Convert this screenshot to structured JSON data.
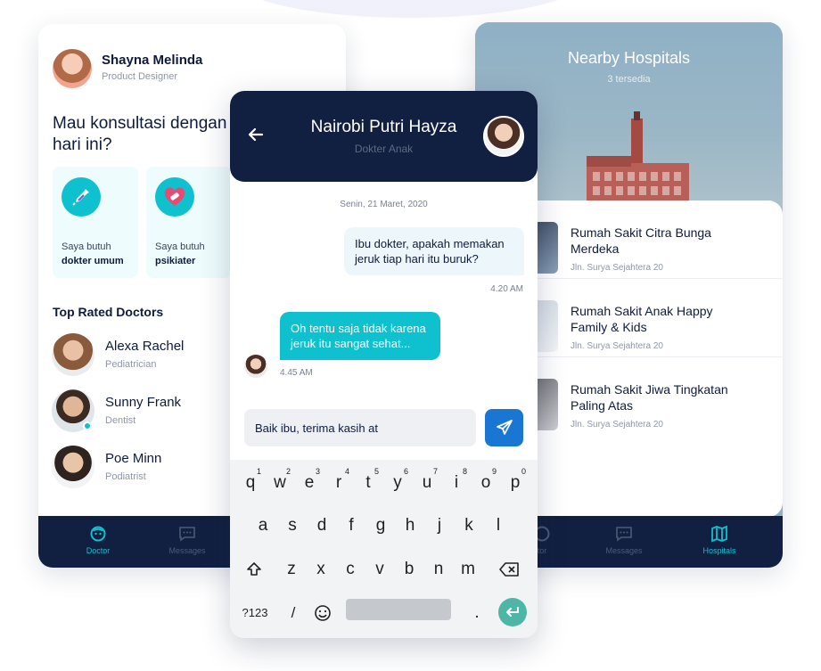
{
  "left_screen": {
    "profile": {
      "name": "Shayna Melinda",
      "role": "Product Designer"
    },
    "consult_title": "Mau konsultasi dengan siapa hari ini?",
    "categories": [
      {
        "icon": "syringe-icon",
        "line1": "Saya butuh",
        "line2": "dokter umum"
      },
      {
        "icon": "heart-bandage-icon",
        "line1": "Saya butuh",
        "line2": "psikiater"
      }
    ],
    "top_rated_title": "Top Rated Doctors",
    "doctors": [
      {
        "name": "Alexa Rachel",
        "specialty": "Pediatrician"
      },
      {
        "name": "Sunny Frank",
        "specialty": "Dentist"
      },
      {
        "name": "Poe Minn",
        "specialty": "Podiatrist"
      }
    ],
    "nav": [
      {
        "label": "Doctor",
        "icon": "doctor-icon",
        "active": true
      },
      {
        "label": "Messages",
        "icon": "message-icon",
        "active": false
      }
    ]
  },
  "right_screen": {
    "title": "Nearby Hospitals",
    "subtitle": "3 tersedia",
    "hospitals": [
      {
        "name": "Rumah Sakit Citra Bunga Merdeka",
        "address": "Jln. Surya Sejahtera 20"
      },
      {
        "name": "Rumah Sakit Anak Happy Family & Kids",
        "address": "Jln. Surya Sejahtera 20"
      },
      {
        "name": "Rumah Sakit Jiwa Tingkatan Paling Atas",
        "address": "Jln. Surya Sejahtera 20"
      }
    ],
    "nav": [
      {
        "label": "tor",
        "icon": "doctor-icon",
        "active": false
      },
      {
        "label": "Messages",
        "icon": "message-icon",
        "active": false
      },
      {
        "label": "Hospitals",
        "icon": "map-icon",
        "active": true
      }
    ]
  },
  "chat": {
    "name": "Nairobi Putri Hayza",
    "role": "Dokter Anak",
    "date": "Senin, 21 Maret, 2020",
    "messages": [
      {
        "from": "me",
        "text": "Ibu dokter, apakah memakan jeruk tiap hari itu buruk?",
        "time": "4.20 AM"
      },
      {
        "from": "doctor",
        "text": "Oh tentu saja tidak karena jeruk itu sangat sehat...",
        "time": "4.45 AM"
      }
    ],
    "input_value": "Baik ibu, terima kasih at"
  },
  "keyboard": {
    "row1": [
      "q",
      "w",
      "e",
      "r",
      "t",
      "y",
      "u",
      "i",
      "o",
      "p"
    ],
    "row1_hints": [
      "1",
      "2",
      "3",
      "4",
      "5",
      "6",
      "7",
      "8",
      "9",
      "0"
    ],
    "row2": [
      "a",
      "s",
      "d",
      "f",
      "g",
      "h",
      "j",
      "k",
      "l"
    ],
    "row3": [
      "z",
      "x",
      "c",
      "v",
      "b",
      "n",
      "m"
    ],
    "symbols_key": "?123",
    "slash_key": "/",
    "period_key": "."
  },
  "colors": {
    "navy": "#112040",
    "accent_cyan": "#0fc0cf",
    "send_blue": "#1976d2",
    "enter_green": "#4eb6a6"
  }
}
